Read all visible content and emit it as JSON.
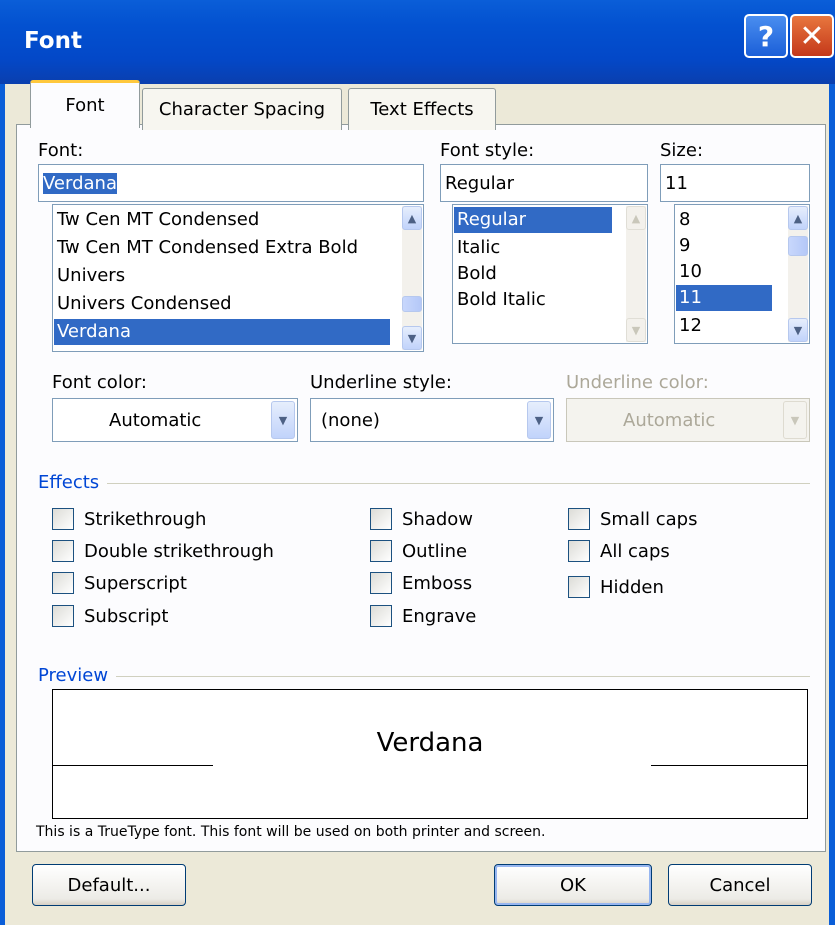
{
  "window": {
    "title": "Font",
    "help_glyph": "?",
    "close_glyph": "✕"
  },
  "tabs": [
    {
      "label": "Font",
      "active": true
    },
    {
      "label": "Character Spacing",
      "active": false
    },
    {
      "label": "Text Effects",
      "active": false
    }
  ],
  "font": {
    "label": "Font:",
    "value": "Verdana",
    "items": [
      "Tw Cen MT Condensed",
      "Tw Cen MT Condensed Extra Bold",
      "Univers",
      "Univers Condensed",
      "Verdana"
    ],
    "selected": "Verdana"
  },
  "font_style": {
    "label": "Font style:",
    "value": "Regular",
    "items": [
      "Regular",
      "Italic",
      "Bold",
      "Bold Italic"
    ],
    "selected": "Regular"
  },
  "size": {
    "label": "Size:",
    "value": "11",
    "items": [
      "8",
      "9",
      "10",
      "11",
      "12"
    ],
    "selected": "11"
  },
  "font_color": {
    "label": "Font color:",
    "value": "Automatic"
  },
  "underline_style": {
    "label": "Underline style:",
    "value": "(none)"
  },
  "underline_color": {
    "label": "Underline color:",
    "value": "Automatic",
    "disabled": true
  },
  "effects": {
    "title": "Effects",
    "col1": [
      "Strikethrough",
      "Double strikethrough",
      "Superscript",
      "Subscript"
    ],
    "col2": [
      "Shadow",
      "Outline",
      "Emboss",
      "Engrave"
    ],
    "col3": [
      "Small caps",
      "All caps",
      "Hidden"
    ]
  },
  "preview": {
    "title": "Preview",
    "sample": "Verdana",
    "note": "This is a TrueType font. This font will be used on both printer and screen."
  },
  "buttons": {
    "default": "Default...",
    "ok": "OK",
    "cancel": "Cancel"
  },
  "colors": {
    "title_bar": "#0a5ed8",
    "selection": "#316ac5",
    "group_title": "#0046d5",
    "tab_highlight": "#ffc83c"
  }
}
